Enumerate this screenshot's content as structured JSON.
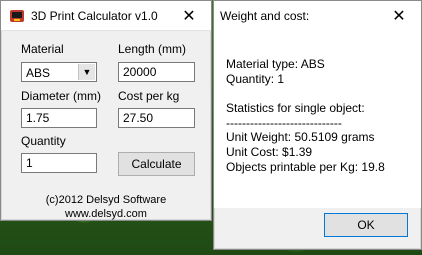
{
  "calculator": {
    "title": "3D Print Calculator v1.0",
    "close_glyph": "✕",
    "material_label": "Material",
    "material_value": "ABS",
    "length_label": "Length (mm)",
    "length_value": "20000",
    "diameter_label": "Diameter (mm)",
    "diameter_value": "1.75",
    "cost_label": "Cost per kg",
    "cost_value": "27.50",
    "quantity_label": "Quantity",
    "quantity_value": "1",
    "calculate_label": "Calculate",
    "footer_line1": "(c)2012 Delsyd Software",
    "footer_line2": "www.delsyd.com"
  },
  "result": {
    "title": "Weight and cost:",
    "close_glyph": "✕",
    "material_type": "Material type: ABS",
    "quantity": "Quantity: 1",
    "stats_heading": "Statistics for single object:",
    "separator": "-----------------------------",
    "unit_weight": "Unit Weight: 50.5109 grams",
    "unit_cost": "Unit Cost: $1.39",
    "objects_per_kg": "Objects printable per Kg: 19.8",
    "ok_label": "OK"
  },
  "icons": {
    "app_icon": "3d-printer-icon",
    "close_icon": "close-icon",
    "dropdown_icon": "chevron-down-icon"
  }
}
